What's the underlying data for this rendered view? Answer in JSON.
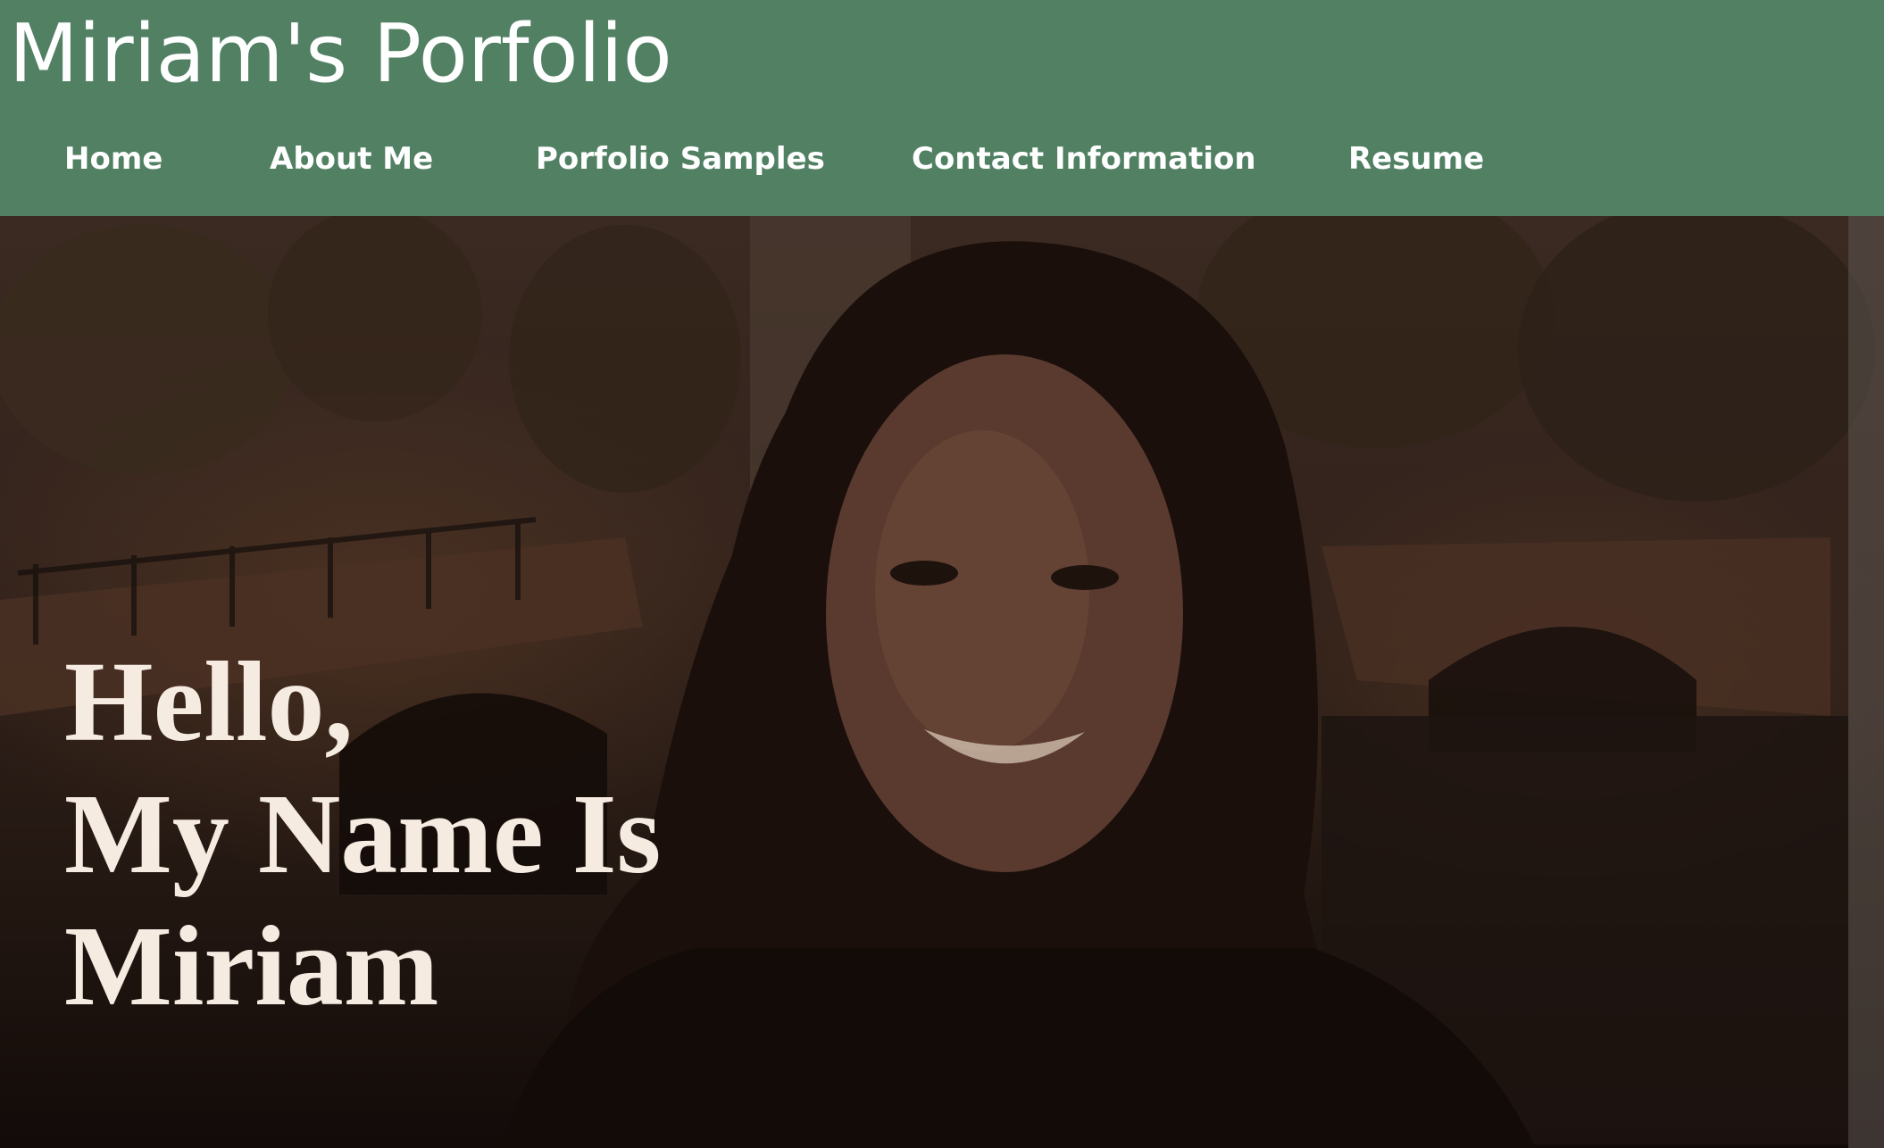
{
  "site": {
    "title": "Miriam's Porfolio"
  },
  "nav": {
    "items": [
      {
        "label": "Home"
      },
      {
        "label": "About Me"
      },
      {
        "label": "Porfolio Samples"
      },
      {
        "label": "Contact Information"
      },
      {
        "label": "Resume"
      }
    ]
  },
  "hero": {
    "lines": [
      "Hello,",
      "My Name Is",
      "Miriam"
    ],
    "image_subject": "portrait-photo"
  },
  "colors": {
    "header_bg": "#518063",
    "header_text": "#ffffff",
    "hero_text": "#f5ebe0",
    "hero_overlay": "#1a1210"
  }
}
